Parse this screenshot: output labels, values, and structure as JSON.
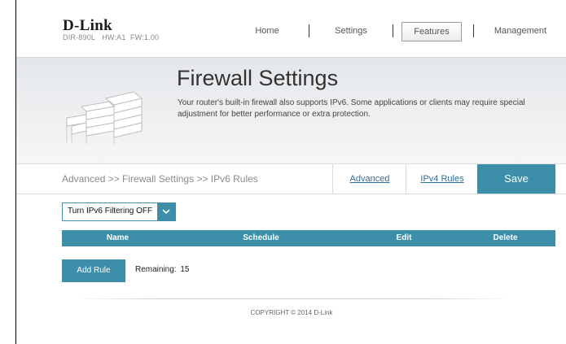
{
  "brand": {
    "logo": "D-Link",
    "model": "DIR-890L",
    "hw": "HW:A1",
    "fw": "FW:1.00"
  },
  "nav": {
    "items": [
      "Home",
      "Settings",
      "Features",
      "Management"
    ],
    "active": "Features"
  },
  "banner": {
    "title": "Firewall Settings",
    "description": "Your router's built-in firewall also supports IPv6. Some applications or clients may require special adjustment for better performance or extra protection."
  },
  "breadcrumb": "Advanced >> Firewall Settings >> IPv6 Rules",
  "actions": {
    "advanced": "Advanced",
    "ipv4_rules": "IPv4 Rules",
    "save": "Save"
  },
  "filter": {
    "value": "Turn IPv6 Filtering OFF"
  },
  "table": {
    "columns": [
      "Name",
      "Schedule",
      "Edit",
      "Delete"
    ]
  },
  "rules": {
    "add_label": "Add Rule",
    "remaining_label": "Remaining:",
    "remaining_count": "15"
  },
  "footer": {
    "copyright": "COPYRIGHT © 2014 D-Link"
  },
  "colors": {
    "accent": "#3d8ea8",
    "link": "#2f6f9a"
  },
  "icons": {
    "banner": "brick-wall-icon",
    "dropdown": "chevron-down-icon"
  }
}
